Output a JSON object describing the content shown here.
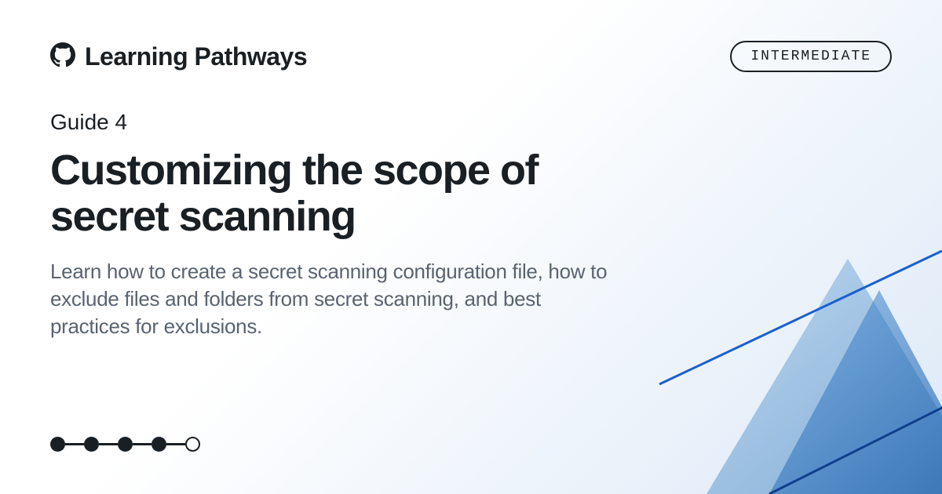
{
  "header": {
    "brand_name": "Learning Pathways",
    "level_badge": "INTERMEDIATE"
  },
  "content": {
    "guide_label": "Guide 4",
    "title": "Customizing the scope of secret scanning",
    "description": "Learn how to create a secret scanning configuration file, how to exclude files and folders from secret scanning, and best practices for exclusions."
  },
  "progress": {
    "total_steps": 5,
    "completed_steps": 4
  }
}
